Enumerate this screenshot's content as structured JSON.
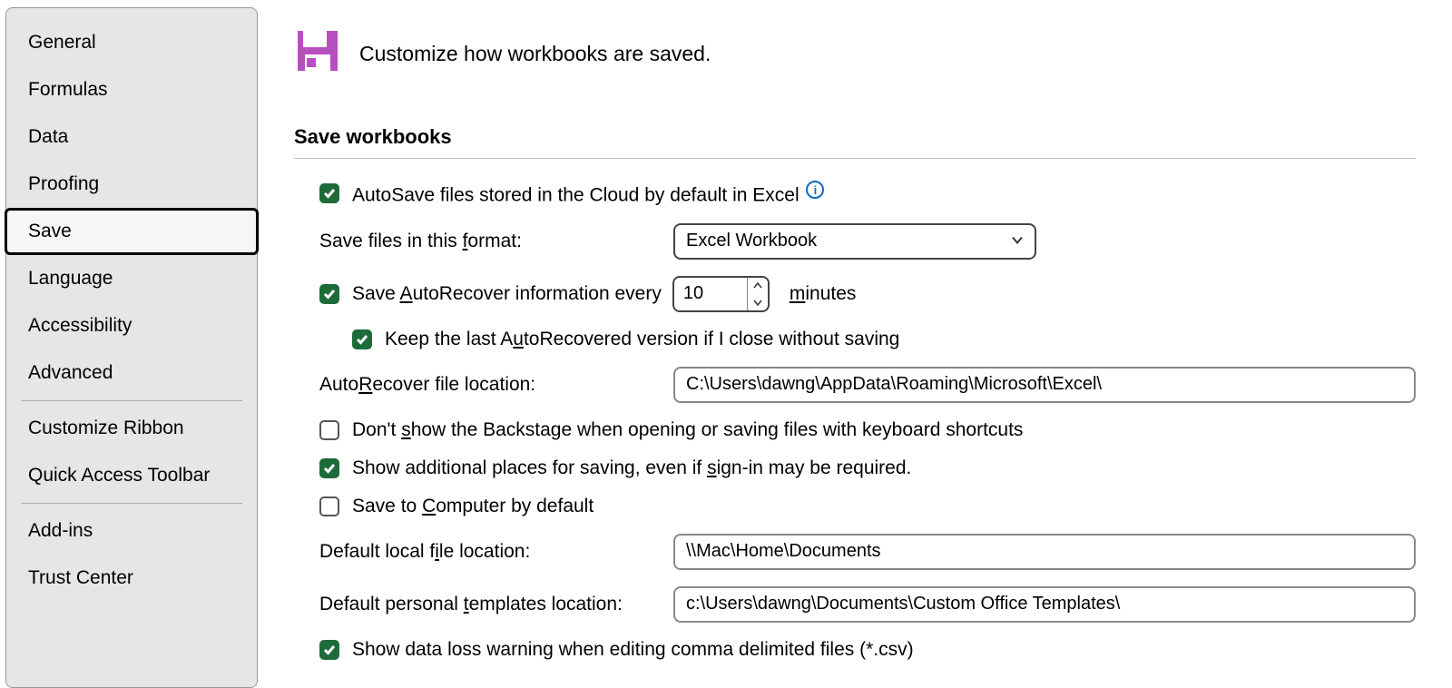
{
  "sidebar": {
    "items": [
      {
        "label": "General"
      },
      {
        "label": "Formulas"
      },
      {
        "label": "Data"
      },
      {
        "label": "Proofing"
      },
      {
        "label": "Save"
      },
      {
        "label": "Language"
      },
      {
        "label": "Accessibility"
      },
      {
        "label": "Advanced"
      },
      {
        "label": "Customize Ribbon"
      },
      {
        "label": "Quick Access Toolbar"
      },
      {
        "label": "Add-ins"
      },
      {
        "label": "Trust Center"
      }
    ],
    "selected": "Save"
  },
  "header": {
    "title": "Customize how workbooks are saved."
  },
  "section": {
    "title": "Save workbooks"
  },
  "options": {
    "autosave": {
      "checked": true,
      "pre": "AutoSave files stored in the Cloud by default in Excel"
    },
    "format": {
      "label_pre": "Save files in this ",
      "label_ak": "f",
      "label_post": "ormat:",
      "value": "Excel Workbook"
    },
    "autorecover": {
      "checked": true,
      "label_pre": "Save ",
      "label_ak": "A",
      "label_post": "utoRecover information every",
      "value": "10",
      "unit_ak": "m",
      "unit_post": "inutes"
    },
    "keeplast": {
      "checked": true,
      "label_pre": "Keep the last A",
      "label_ak": "u",
      "label_post": "toRecovered version if I close without saving"
    },
    "arlocation": {
      "label_pre": "Auto",
      "label_ak": "R",
      "label_post": "ecover file location:",
      "value": "C:\\Users\\dawng\\AppData\\Roaming\\Microsoft\\Excel\\"
    },
    "backstage": {
      "checked": false,
      "label_pre": "Don't ",
      "label_ak": "s",
      "label_post": "how the Backstage when opening or saving files with keyboard shortcuts"
    },
    "addplaces": {
      "checked": true,
      "label_pre": "Show additional places for saving, even if ",
      "label_ak": "s",
      "label_post": "ign-in may be required."
    },
    "savecomputer": {
      "checked": false,
      "label_pre": "Save to ",
      "label_ak": "C",
      "label_post": "omputer by default"
    },
    "localloc": {
      "label_pre": "Default local f",
      "label_ak": "i",
      "label_post": "le location:",
      "value": "\\\\Mac\\Home\\Documents"
    },
    "tmplloc": {
      "label_pre": "Default personal ",
      "label_ak": "t",
      "label_post": "emplates location:",
      "value": "c:\\Users\\dawng\\Documents\\Custom Office Templates\\"
    },
    "csvwarn": {
      "checked": true,
      "label": "Show data loss warning when editing comma delimited files (*.csv)"
    }
  }
}
